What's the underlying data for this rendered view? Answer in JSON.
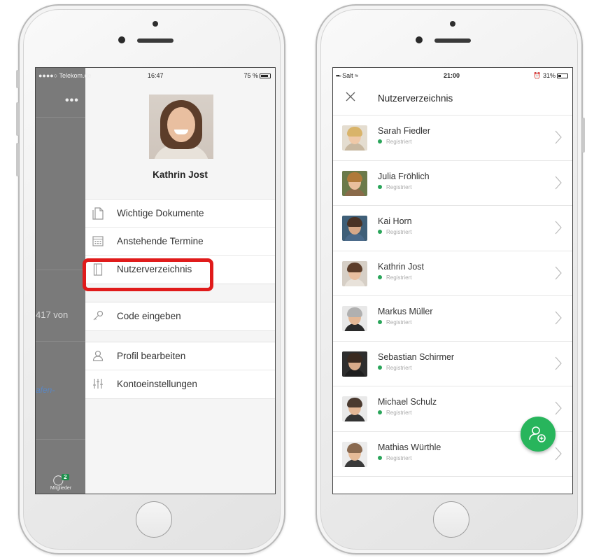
{
  "left_screen": {
    "status": {
      "carrier": "●●●●○ Telekom.de",
      "time": "16:47",
      "battery": "75 %"
    },
    "background": {
      "menu_dots": "•••",
      "peek_text": "417 von",
      "peek_link": "afen-",
      "members_tab": {
        "label": "Mitglieder",
        "badge": "2"
      }
    },
    "profile": {
      "name": "Kathrin Jost"
    },
    "menu_groups": [
      [
        {
          "label": "Wichtige Dokumente",
          "icon": "documents-icon"
        },
        {
          "label": "Anstehende Termine",
          "icon": "calendar-icon"
        },
        {
          "label": "Nutzerverzeichnis",
          "icon": "address-book-icon"
        }
      ],
      [
        {
          "label": "Code eingeben",
          "icon": "key-icon"
        }
      ],
      [
        {
          "label": "Profil bearbeiten",
          "icon": "user-icon"
        },
        {
          "label": "Kontoeinstellungen",
          "icon": "sliders-icon"
        }
      ]
    ]
  },
  "right_screen": {
    "status": {
      "carrier": "Salt",
      "time": "21:00",
      "battery": "31%"
    },
    "navbar": {
      "title": "Nutzerverzeichnis",
      "close_icon": "close-icon"
    },
    "users": [
      {
        "name": "Sarah Fiedler",
        "status": "Registriert"
      },
      {
        "name": "Julia Fröhlich",
        "status": "Registriert"
      },
      {
        "name": "Kai Horn",
        "status": "Registriert"
      },
      {
        "name": "Kathrin Jost",
        "status": "Registriert"
      },
      {
        "name": "Markus Müller",
        "status": "Registriert"
      },
      {
        "name": "Sebastian Schirmer",
        "status": "Registriert"
      },
      {
        "name": "Michael Schulz",
        "status": "Registriert"
      },
      {
        "name": "Mathias Würthle",
        "status": "Registriert"
      }
    ],
    "fab_icon": "add-user-icon",
    "colors": {
      "accent_green": "#28b55c",
      "status_green": "#2aa55a",
      "highlight_red": "#e01b1b"
    }
  }
}
